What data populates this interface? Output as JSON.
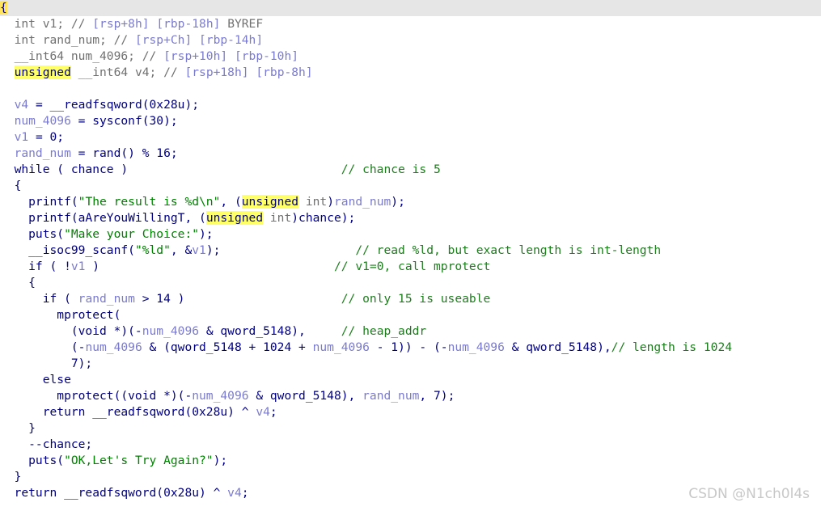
{
  "editor": {
    "lines": [
      [
        {
          "t": "{",
          "c": "caret"
        }
      ],
      [
        {
          "t": "  "
        },
        {
          "t": "int",
          "c": "t"
        },
        {
          "t": " "
        },
        {
          "t": "v1",
          "c": "t"
        },
        {
          "t": "; // ",
          "c": "t"
        },
        {
          "t": "[rsp+8h] [rbp-18h]",
          "c": "v"
        },
        {
          "t": " BYREF",
          "c": "t"
        }
      ],
      [
        {
          "t": "  "
        },
        {
          "t": "int",
          "c": "t"
        },
        {
          "t": " rand_num; // ",
          "c": "t"
        },
        {
          "t": "[rsp+Ch] [rbp-14h]",
          "c": "v"
        }
      ],
      [
        {
          "t": "  __int64 num_4096; // ",
          "c": "t"
        },
        {
          "t": "[rsp+10h] [rbp-10h]",
          "c": "v"
        }
      ],
      [
        {
          "t": "  "
        },
        {
          "t": "unsigned",
          "c": "hl"
        },
        {
          "t": " __int64 v4; // ",
          "c": "t"
        },
        {
          "t": "[rsp+18h] [rbp-8h]",
          "c": "v"
        }
      ],
      [
        {
          "t": ""
        }
      ],
      [
        {
          "t": "  "
        },
        {
          "t": "v4",
          "c": "v"
        },
        {
          "t": " = __readfsqword(0x28u);"
        }
      ],
      [
        {
          "t": "  "
        },
        {
          "t": "num_4096",
          "c": "v"
        },
        {
          "t": " = sysconf(30);"
        }
      ],
      [
        {
          "t": "  "
        },
        {
          "t": "v1",
          "c": "v"
        },
        {
          "t": " = 0;"
        }
      ],
      [
        {
          "t": "  "
        },
        {
          "t": "rand_num",
          "c": "v"
        },
        {
          "t": " = rand() % 16;"
        }
      ],
      [
        {
          "t": "  while ( chance )                              "
        },
        {
          "t": "// chance is 5",
          "c": "c"
        }
      ],
      [
        {
          "t": "  {"
        }
      ],
      [
        {
          "t": "    printf("
        },
        {
          "t": "\"The result is %d\\n\"",
          "c": "s"
        },
        {
          "t": ", ("
        },
        {
          "t": "unsigned",
          "c": "hl"
        },
        {
          "t": " int",
          "c": "t"
        },
        {
          "t": ")"
        },
        {
          "t": "rand_num",
          "c": "v"
        },
        {
          "t": ");"
        }
      ],
      [
        {
          "t": "    printf(aAreYouWillingT, ("
        },
        {
          "t": "unsigned",
          "c": "hl"
        },
        {
          "t": " int",
          "c": "t"
        },
        {
          "t": ")chance);"
        }
      ],
      [
        {
          "t": "    puts("
        },
        {
          "t": "\"Make your Choice:\"",
          "c": "s"
        },
        {
          "t": ");"
        }
      ],
      [
        {
          "t": "    __isoc99_scanf("
        },
        {
          "t": "\"%ld\"",
          "c": "s"
        },
        {
          "t": ", &"
        },
        {
          "t": "v1",
          "c": "v"
        },
        {
          "t": ");                   "
        },
        {
          "t": "// read %ld, but exact length is int-length",
          "c": "c"
        }
      ],
      [
        {
          "t": "    if ( !"
        },
        {
          "t": "v1",
          "c": "v"
        },
        {
          "t": " )                                 "
        },
        {
          "t": "// v1=0, call mprotect",
          "c": "c"
        }
      ],
      [
        {
          "t": "    {"
        }
      ],
      [
        {
          "t": "      if ( "
        },
        {
          "t": "rand_num",
          "c": "v"
        },
        {
          "t": " > 14 )                      "
        },
        {
          "t": "// only 15 is useable",
          "c": "c"
        }
      ],
      [
        {
          "t": "        mprotect("
        }
      ],
      [
        {
          "t": "          (void *)(-"
        },
        {
          "t": "num_4096",
          "c": "v"
        },
        {
          "t": " & qword_5148),     "
        },
        {
          "t": "// heap_addr",
          "c": "c"
        }
      ],
      [
        {
          "t": "          (-"
        },
        {
          "t": "num_4096",
          "c": "v"
        },
        {
          "t": " & (qword_5148 + 1024 + "
        },
        {
          "t": "num_4096",
          "c": "v"
        },
        {
          "t": " - 1)) - (-"
        },
        {
          "t": "num_4096",
          "c": "v"
        },
        {
          "t": " & qword_5148),"
        },
        {
          "t": "// length is 1024",
          "c": "c"
        }
      ],
      [
        {
          "t": "          7);"
        }
      ],
      [
        {
          "t": "      else"
        }
      ],
      [
        {
          "t": "        mprotect((void *)(-"
        },
        {
          "t": "num_4096",
          "c": "v"
        },
        {
          "t": " & qword_5148), "
        },
        {
          "t": "rand_num",
          "c": "v"
        },
        {
          "t": ", 7);"
        }
      ],
      [
        {
          "t": "      return __readfsqword(0x28u) ^ "
        },
        {
          "t": "v4",
          "c": "v"
        },
        {
          "t": ";"
        }
      ],
      [
        {
          "t": "    }"
        }
      ],
      [
        {
          "t": "    --chance;"
        }
      ],
      [
        {
          "t": "    puts("
        },
        {
          "t": "\"OK,Let's Try Again?\"",
          "c": "s"
        },
        {
          "t": ");"
        }
      ],
      [
        {
          "t": "  }"
        }
      ],
      [
        {
          "t": "  return __readfsqword(0x28u) ^ "
        },
        {
          "t": "v4",
          "c": "v"
        },
        {
          "t": ";"
        }
      ]
    ]
  },
  "watermark": "CSDN @N1ch0l4s"
}
